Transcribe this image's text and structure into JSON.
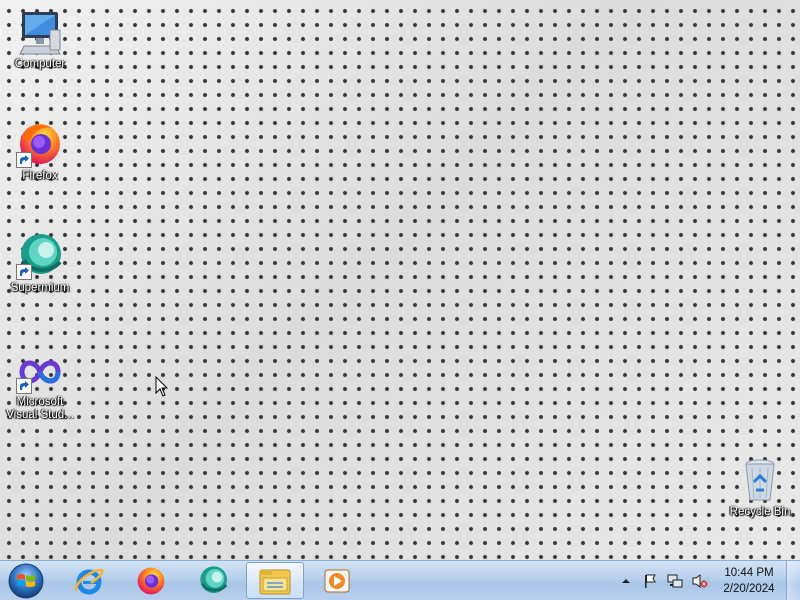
{
  "desktop": {
    "icons": [
      {
        "label": "Computer",
        "icon": "computer-icon"
      },
      {
        "label": "Firefox",
        "icon": "firefox-icon"
      },
      {
        "label": "Supermium",
        "icon": "supermium-icon"
      },
      {
        "label": "Microsoft\nVisual Stud...",
        "icon": "visual-studio-icon"
      },
      {
        "label": "Recycle Bin",
        "icon": "recycle-bin-icon"
      }
    ]
  },
  "taskbar": {
    "start": {
      "icon": "windows-start-icon"
    },
    "pinned": [
      {
        "icon": "internet-explorer-icon",
        "active": false
      },
      {
        "icon": "firefox-icon",
        "active": false
      },
      {
        "icon": "supermium-icon",
        "active": false
      },
      {
        "icon": "file-explorer-icon",
        "active": true
      },
      {
        "icon": "media-player-icon",
        "active": false
      }
    ],
    "tray": {
      "icons": [
        "show-hidden-icons-arrow",
        "action-center-flag-icon",
        "network-icon",
        "volume-muted-icon"
      ],
      "time": "10:44 PM",
      "date": "2/20/2024"
    }
  }
}
